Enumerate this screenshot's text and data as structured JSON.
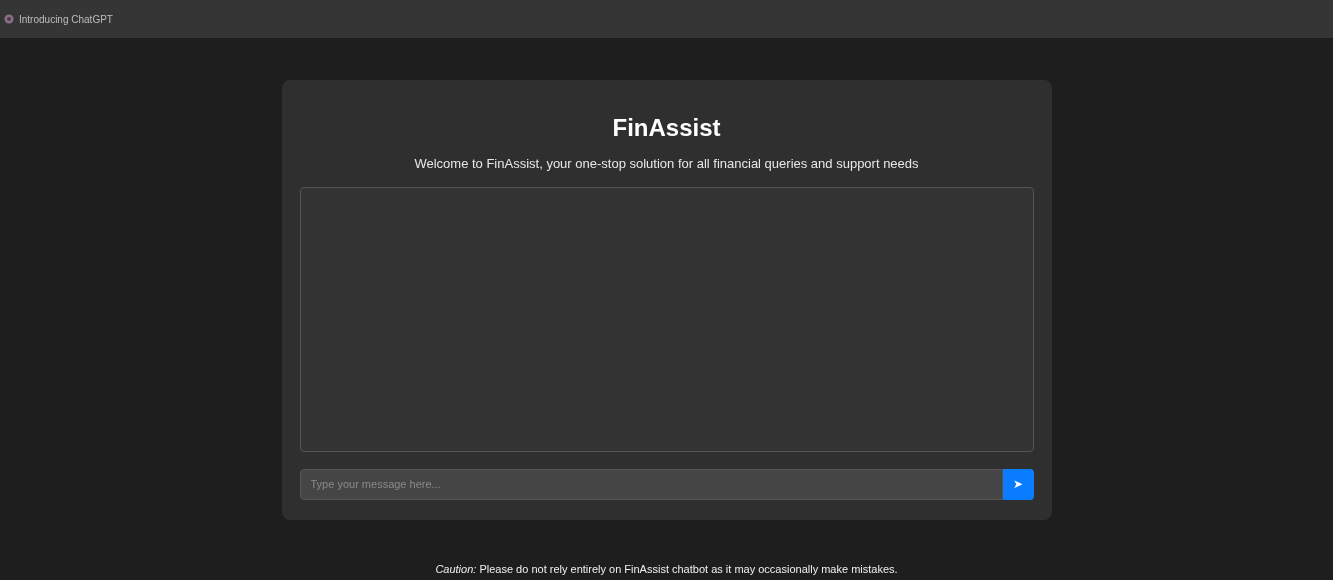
{
  "tab": {
    "title": "Introducing ChatGPT"
  },
  "app": {
    "title": "FinAssist",
    "subtitle": "Welcome to FinAssist, your one-stop solution for all financial queries and support needs"
  },
  "message_input": {
    "placeholder": "Type your message here..."
  },
  "send_button": {
    "label": "➤"
  },
  "footer": {
    "text": "*Caution:* Please do not rely entirely on FinAssist chatbot as it may occasionally make mistakes."
  }
}
